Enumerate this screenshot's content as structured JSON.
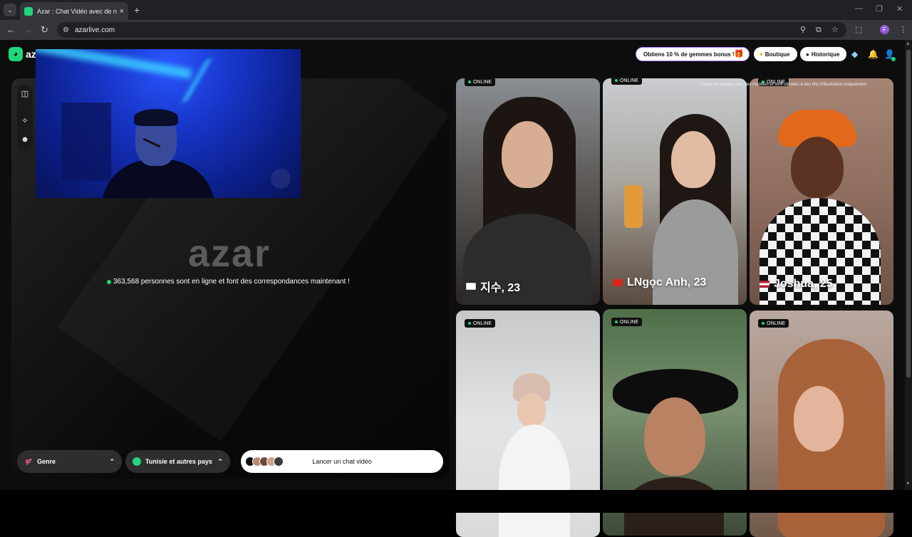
{
  "browser": {
    "tab_title": "Azar : Chat Vidéo avec de nouv",
    "url": "azarlive.com",
    "profile_initial": "F"
  },
  "header": {
    "logo_text": "az",
    "promo_label": "Obtiens 10 % de gemmes bonus !",
    "shop_label": "Boutique",
    "history_label": "Historique"
  },
  "main": {
    "brand_watermark": "azar",
    "online_text": "363,568 personnes sont en ligne et font des correspondances maintenant !"
  },
  "controls": {
    "gender_label": "Genre",
    "country_label": "Tunisie et autres pays",
    "launch_label": "Lancer un chat vidéo"
  },
  "profiles": {
    "online_label": "ONLINE",
    "disclaimer": "Toutes les images sont des modèles et sont utilisées à des fins d'illustration uniquement.",
    "cards": [
      {
        "name": "지수, 23",
        "flag": "Korea"
      },
      {
        "name": "LNgọc Anh, 23",
        "flag": "Vietnam"
      },
      {
        "name": "Joshua, 25",
        "flag": "USA"
      },
      {
        "name": "",
        "flag": ""
      },
      {
        "name": "",
        "flag": ""
      },
      {
        "name": "",
        "flag": ""
      }
    ]
  },
  "colors": {
    "accent": "#22d47b",
    "promo_border": "#a77cf5"
  }
}
